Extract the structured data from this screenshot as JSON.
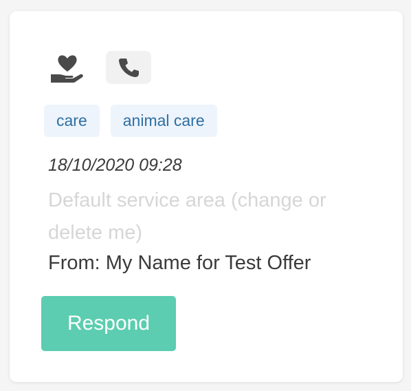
{
  "card": {
    "icons": {
      "care": "hand-heart-icon",
      "phone": "phone-icon"
    },
    "tags": [
      "care",
      "animal care"
    ],
    "timestamp": "18/10/2020 09:28",
    "service_area": "Default service area (change or delete me)",
    "from": "From: My Name for Test Offer",
    "respond_label": "Respond"
  },
  "colors": {
    "accent": "#5ccdb0",
    "tag_bg": "#eef4fb",
    "tag_text": "#2e6fa3",
    "icon": "#4a4a4a",
    "muted_text": "#d6d6d6"
  }
}
